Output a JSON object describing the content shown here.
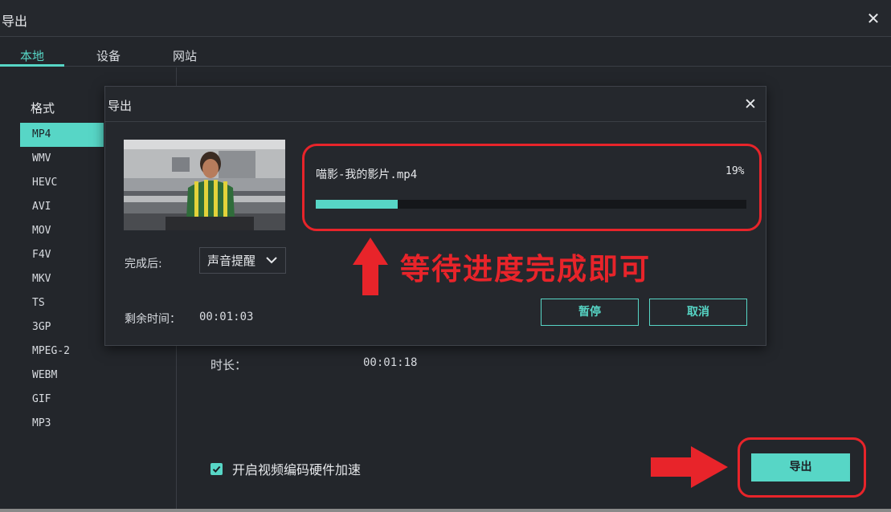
{
  "window": {
    "title": "导出",
    "close_glyph": "✕"
  },
  "tabs": [
    {
      "label": "本地",
      "active": true
    },
    {
      "label": "设备",
      "active": false
    },
    {
      "label": "网站",
      "active": false
    }
  ],
  "sidebar": {
    "heading": "格式",
    "formats": [
      "MP4",
      "WMV",
      "HEVC",
      "AVI",
      "MOV",
      "F4V",
      "MKV",
      "TS",
      "3GP",
      "MPEG-2",
      "WEBM",
      "GIF",
      "MP3"
    ],
    "selected": "MP4"
  },
  "details": {
    "duration_label": "时长：",
    "duration_value": "00:01:18"
  },
  "footer": {
    "hw_accel_label": "开启视频编码硬件加速",
    "hw_accel_checked": true,
    "export_label": "导出"
  },
  "dialog": {
    "title": "导出",
    "close_glyph": "✕",
    "file_name": "喵影-我的影片.mp4",
    "percent_text": "19%",
    "progress": 0.19,
    "after_label": "完成后:",
    "after_value": "声音提醒",
    "remaining_label": "剩余时间：",
    "remaining_value": "00:01:03",
    "pause_label": "暂停",
    "cancel_label": "取消"
  },
  "annotation": {
    "text": "等待进度完成即可"
  },
  "colors": {
    "accent": "#57d6c6",
    "annotation_red": "#e8242a",
    "background": "#23262b"
  },
  "icons": [
    "close-icon",
    "chevron-down-icon",
    "check-icon",
    "up-arrow-icon",
    "right-arrow-icon"
  ]
}
